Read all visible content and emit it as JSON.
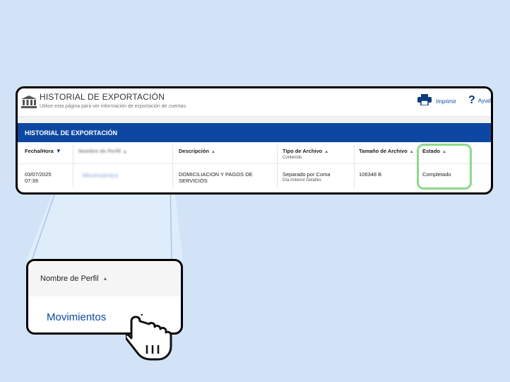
{
  "header": {
    "title": "HISTORIAL DE EXPORTACIÓN",
    "subtitle": "Utilice esta página para ver información de exportación de cuentas.",
    "print_label": "Imprimir",
    "help_label": "Ayuda"
  },
  "section_bar": {
    "title": "HISTORIAL DE EXPORTACIÓN"
  },
  "table": {
    "columns": {
      "date": "Fecha/Hora",
      "profile": "Nombre de Perfil",
      "description": "Descripción",
      "file_type": "Tipo de Archivo",
      "file_type_sub": "Contenido",
      "file_size": "Tamaño de Archivo",
      "status": "Estado"
    },
    "row": {
      "date": "03/07/2025",
      "time": "07:39",
      "profile": "Movimientos",
      "description": "DOMICILIACION Y PAGOS DE SERVICIOS",
      "file_type": "Separado por Coma",
      "content": "Día Anterior Detalles",
      "file_size": "106348 B",
      "status": "Completado"
    }
  },
  "zoom": {
    "header": "Nombre de Perfil",
    "link": "Movimientos"
  },
  "colors": {
    "background": "#d3e3f7",
    "header_bar": "#0d47a1",
    "link": "#0d47a1",
    "highlight": "#8fd88b"
  },
  "icons": [
    "bank-icon",
    "printer-icon",
    "help-icon",
    "sort-desc-icon",
    "sort-asc-icon",
    "pointer-hand-icon"
  ]
}
